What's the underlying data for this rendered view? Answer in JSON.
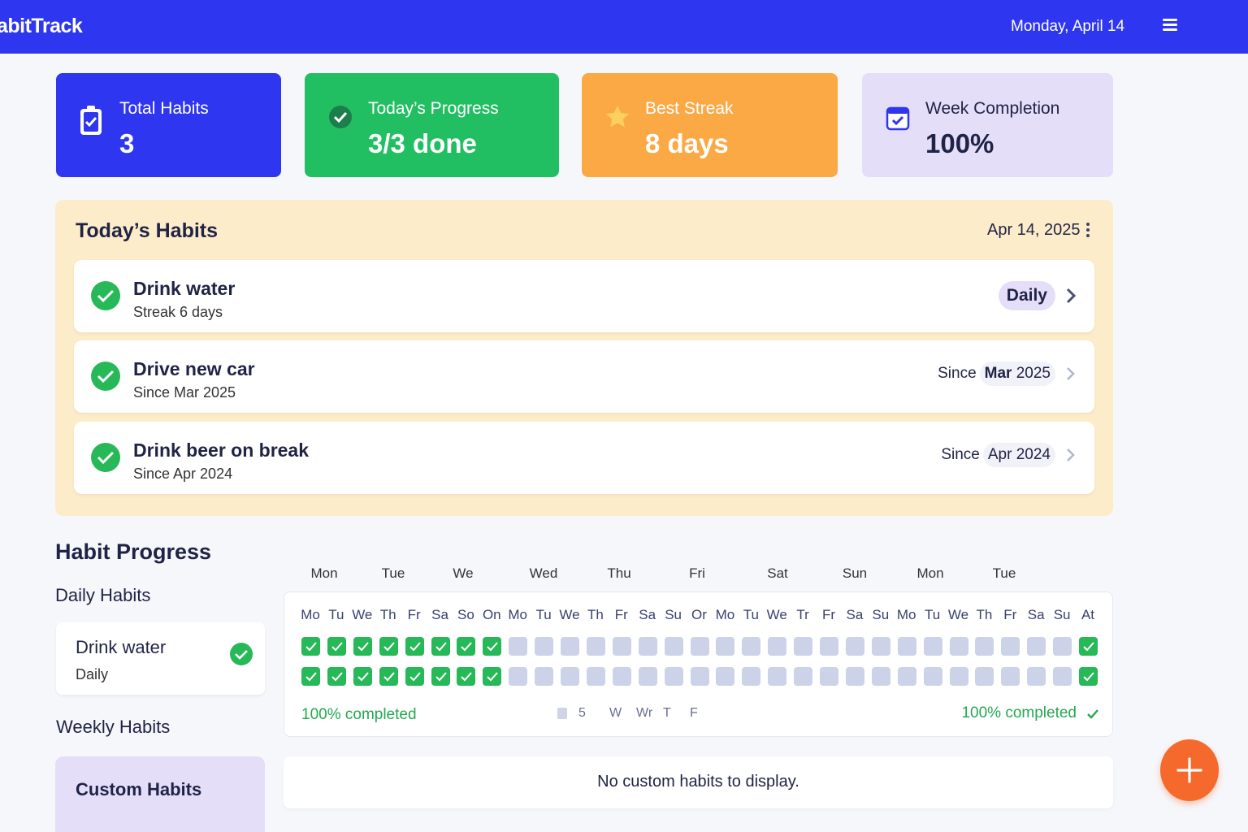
{
  "header": {
    "brand": "abitTrack",
    "date": "Monday, April 14"
  },
  "stats": [
    {
      "label": "Total Habits",
      "value": "3",
      "icon": "clipboard-check-icon"
    },
    {
      "label": "Today’s Progress",
      "value": "3/3 done",
      "icon": "check-circle-icon"
    },
    {
      "label": "Best Streak",
      "value": "8 days",
      "icon": "star-icon"
    },
    {
      "label": "Week Completion",
      "value": "100%",
      "icon": "calendar-check-icon"
    }
  ],
  "today": {
    "title": "Today’s Habits",
    "date": "Apr 14, 2025",
    "habits": [
      {
        "name": "Drink water",
        "sub": "Streak 6 days",
        "badge": "Daily"
      },
      {
        "name": "Drive new car",
        "sub": "Since Mar 2025",
        "since": "Since",
        "since_month": "Mar",
        "since_year": "2025"
      },
      {
        "name": "Drink beer on break",
        "sub": "Since Apr 2024",
        "since": "Since",
        "since_month": "Apr",
        "since_year": "2024"
      }
    ]
  },
  "progress": {
    "title": "Habit Progress",
    "daily_title": "Daily Habits",
    "daily_card": {
      "name": "Drink water",
      "sub": "Daily"
    },
    "weekly_title": "Weekly Habits",
    "custom_title": "Custom Habits",
    "weekdays": [
      "Mon",
      "Tue",
      "We",
      "Wed",
      "Thu",
      "Fri",
      "Sat",
      "Sun",
      "Mon",
      "Tue"
    ],
    "day_labels": [
      "Mo",
      "Tu",
      "We",
      "Th",
      "Fr",
      "Sa",
      "So",
      "On",
      "Mo",
      "Tu",
      "We",
      "Th",
      "Fr",
      "Sa",
      "Su",
      "Or",
      "Mo",
      "Tu",
      "We",
      "Tr",
      "Fr",
      "Sa",
      "Su",
      "Mo",
      "Tu",
      "We",
      "Th",
      "Fr",
      "Sa",
      "Su",
      "At"
    ],
    "rows": [
      [
        1,
        1,
        1,
        1,
        1,
        1,
        1,
        1,
        0,
        0,
        0,
        0,
        0,
        0,
        0,
        0,
        0,
        0,
        0,
        0,
        0,
        0,
        0,
        0,
        0,
        0,
        0,
        0,
        0,
        0,
        1
      ],
      [
        1,
        1,
        1,
        1,
        1,
        1,
        1,
        1,
        0,
        0,
        0,
        0,
        0,
        0,
        0,
        0,
        0,
        0,
        0,
        0,
        0,
        0,
        0,
        0,
        0,
        0,
        0,
        0,
        0,
        0,
        1
      ]
    ],
    "left_pct": "100% completed",
    "right_pct": "100% completed",
    "mini_labels": [
      "5",
      "W",
      "Wr",
      "T",
      "F"
    ],
    "custom_empty": "No custom habits to display."
  },
  "colors": {
    "primary": "#2e36f0",
    "success": "#22bf62",
    "warning": "#fba945",
    "lavender": "#e4def9",
    "fab": "#f56a2c"
  }
}
